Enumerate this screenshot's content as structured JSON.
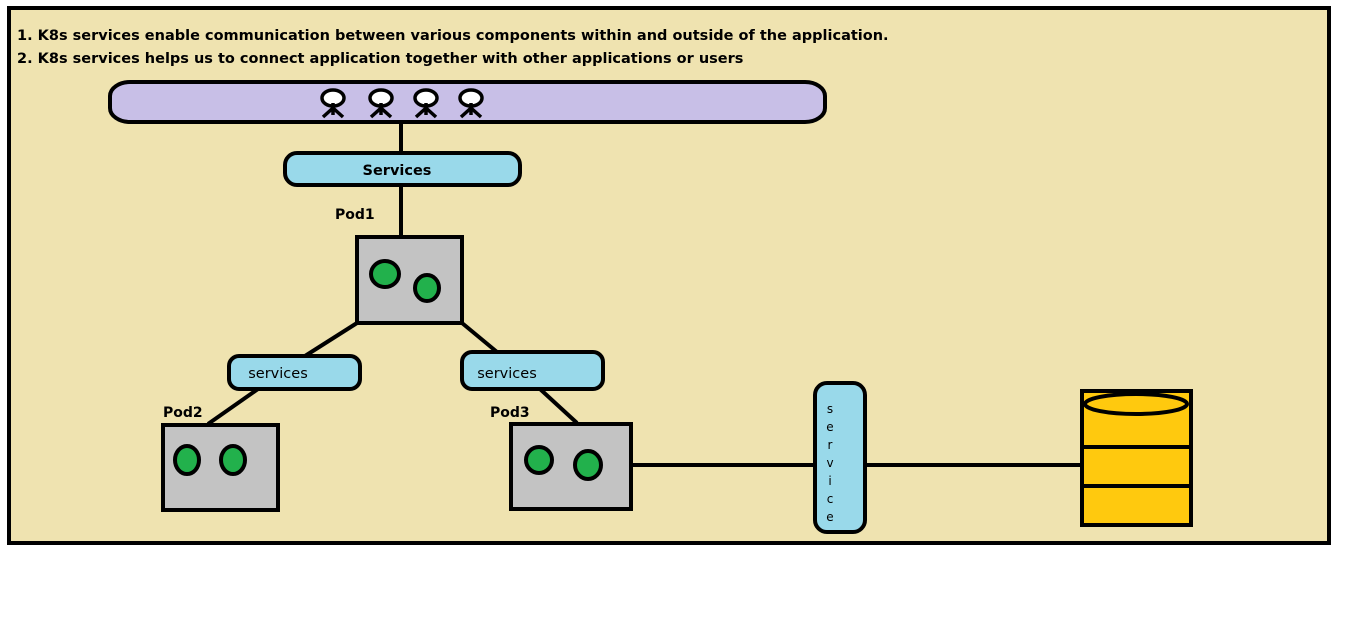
{
  "notes": [
    "1. K8s services enable communication between various components within and outside of the application.",
    "2. K8s services helps us to connect application together with other applications or users"
  ],
  "users_bar": {
    "icon": "user-icon",
    "count": 4
  },
  "top_service": {
    "label": "Services"
  },
  "pods": [
    {
      "label": "Pod1",
      "containers": 2
    },
    {
      "label": "Pod2",
      "containers": 2
    },
    {
      "label": "Pod3",
      "containers": 2
    }
  ],
  "pod_services": [
    {
      "label": "services"
    },
    {
      "label": "services"
    }
  ],
  "db_service": {
    "letters": [
      "s",
      "e",
      "r",
      "v",
      "i",
      "c",
      "e"
    ]
  },
  "database": {
    "icon": "database-icon"
  },
  "colors": {
    "background": "#EFE3B0",
    "users_bar": "#C8BFE7",
    "service": "#99D9EA",
    "pod": "#C3C3C3",
    "container": "#22B14C",
    "database": "#FFC90E"
  }
}
